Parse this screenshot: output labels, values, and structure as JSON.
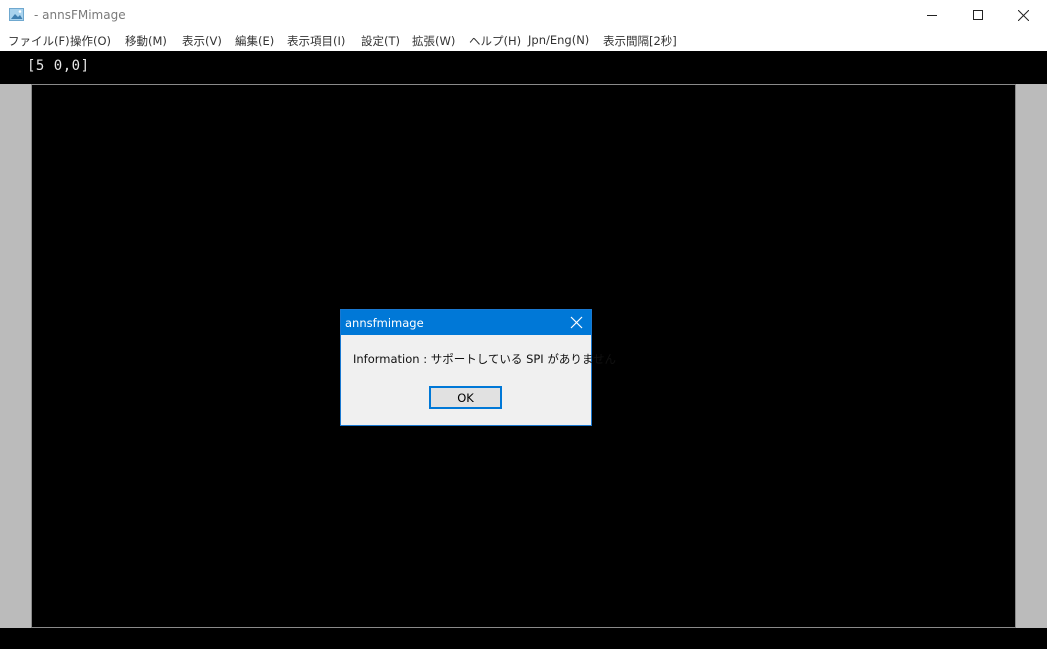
{
  "window": {
    "title": "- annsFMimage"
  },
  "menu": [
    {
      "label": "ファイル(F)"
    },
    {
      "label": "操作(O)"
    },
    {
      "label": "移動(M)"
    },
    {
      "label": "表示(V)"
    },
    {
      "label": "編集(E)"
    },
    {
      "label": "表示項目(I)"
    },
    {
      "label": "設定(T)"
    },
    {
      "label": "拡張(W)"
    },
    {
      "label": "ヘルプ(H)"
    },
    {
      "label": "Jpn/Eng(N)"
    },
    {
      "label": "表示間隔[2秒]"
    }
  ],
  "status": {
    "coords": "[5 0,0]"
  },
  "dialog": {
    "title": "annsfmimage",
    "message": "Information : サポートしている SPI がありません",
    "ok_label": "OK"
  },
  "colors": {
    "dialog_accent": "#0078d7",
    "canvas_bg": "#000000",
    "gutter": "#bbbbbb"
  },
  "icons": {
    "app": "image-icon",
    "minimize": "minimize-icon",
    "maximize": "maximize-icon",
    "close": "close-icon"
  }
}
